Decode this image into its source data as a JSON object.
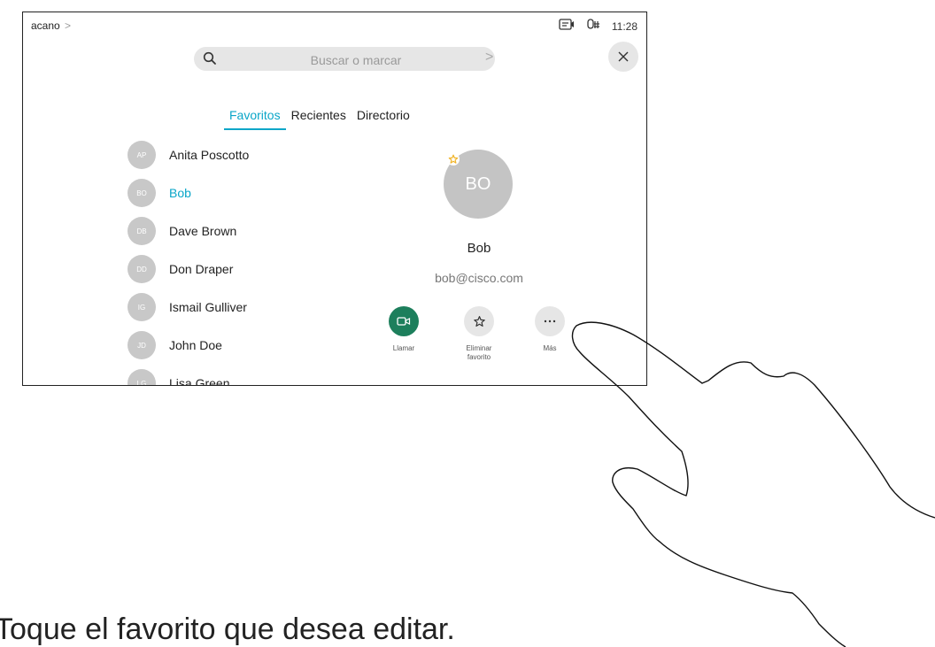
{
  "header": {
    "brand": "acano",
    "time": "11:28"
  },
  "search": {
    "placeholder": "Buscar o marcar"
  },
  "tabs": [
    {
      "label": "Favoritos",
      "active": true
    },
    {
      "label": "Recientes"
    },
    {
      "label": "Directorio"
    }
  ],
  "contacts": [
    {
      "initials": "AP",
      "name": "Anita Poscotto"
    },
    {
      "initials": "BO",
      "name": "Bob",
      "selected": true
    },
    {
      "initials": "DB",
      "name": "Dave Brown"
    },
    {
      "initials": "DD",
      "name": "Don Draper"
    },
    {
      "initials": "IG",
      "name": "Ismail Gulliver"
    },
    {
      "initials": "JD",
      "name": "John Doe"
    },
    {
      "initials": "LG",
      "name": "Lisa Green"
    }
  ],
  "detail": {
    "initials": "BO",
    "name": "Bob",
    "email": "bob@cisco.com",
    "actions": [
      {
        "label": "Llamar",
        "icon": "video-camera-icon"
      },
      {
        "label": "Eliminar favorito",
        "icon": "star-icon"
      },
      {
        "label": "Más",
        "icon": "more-icon"
      }
    ]
  },
  "caption": "Toque el favorito que desea editar.",
  "colors": {
    "accent": "#0aa6c8",
    "call": "#1d7f5c",
    "favorite": "#f0b429",
    "avatar": "#c8c8c8"
  }
}
